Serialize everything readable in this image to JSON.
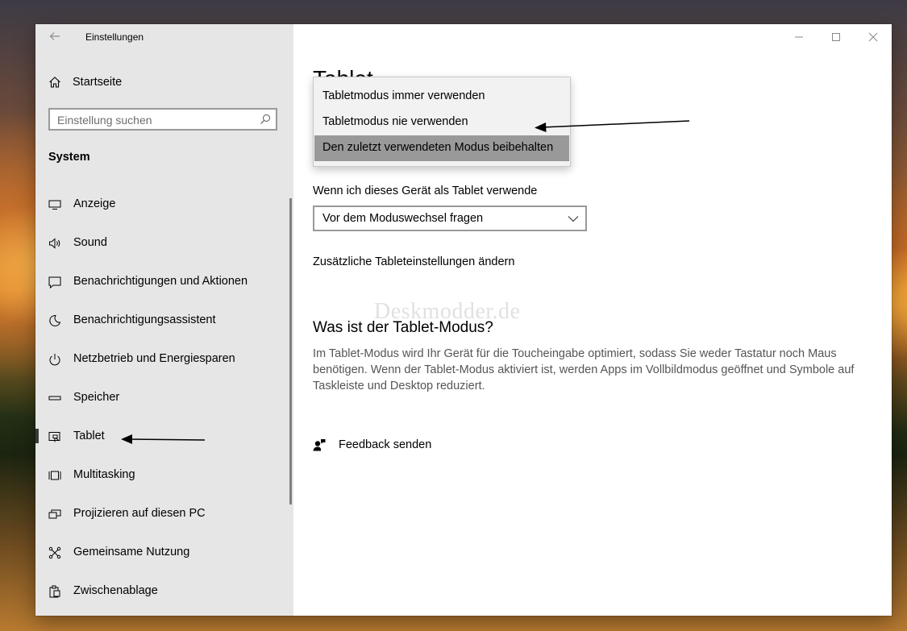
{
  "window": {
    "title": "Einstellungen"
  },
  "sidebar": {
    "home_label": "Startseite",
    "search_placeholder": "Einstellung suchen",
    "section_title": "System",
    "items": [
      {
        "label": "Anzeige",
        "icon": "display-icon"
      },
      {
        "label": "Sound",
        "icon": "speaker-icon"
      },
      {
        "label": "Benachrichtigungen und Aktionen",
        "icon": "notification-icon"
      },
      {
        "label": "Benachrichtigungsassistent",
        "icon": "moon-icon"
      },
      {
        "label": "Netzbetrieb und Energiesparen",
        "icon": "power-icon"
      },
      {
        "label": "Speicher",
        "icon": "storage-icon"
      },
      {
        "label": "Tablet",
        "icon": "tablet-icon",
        "selected": true
      },
      {
        "label": "Multitasking",
        "icon": "multitasking-icon"
      },
      {
        "label": "Projizieren auf diesen PC",
        "icon": "project-icon"
      },
      {
        "label": "Gemeinsame Nutzung",
        "icon": "share-icon"
      },
      {
        "label": "Zwischenablage",
        "icon": "clipboard-icon"
      }
    ]
  },
  "content": {
    "page_title": "Tablet",
    "tablet_question_label": "Wenn ich dieses Gerät als Tablet verwende",
    "tablet_question_value": "Vor dem Moduswechsel fragen",
    "extra_link": "Zusätzliche Tableteinstellungen ändern",
    "watermark": "Deskmodder.de",
    "info_heading": "Was ist der Tablet-Modus?",
    "info_text": "Im Tablet-Modus wird Ihr Gerät für die Toucheingabe optimiert, sodass Sie weder Tastatur noch Maus benötigen. Wenn der Tablet-Modus aktiviert ist, werden Apps im Vollbildmodus geöffnet und Symbole auf Taskleiste und Desktop reduziert.",
    "feedback_label": "Feedback senden"
  },
  "dropdown": {
    "options": [
      "Tabletmodus immer verwenden",
      "Tabletmodus nie verwenden",
      "Den zuletzt verwendeten Modus beibehalten"
    ],
    "selected_index": 2
  },
  "colors": {
    "sidebar_bg": "#e6e6e6",
    "selected_option_bg": "#999999",
    "description_text": "#555555"
  }
}
